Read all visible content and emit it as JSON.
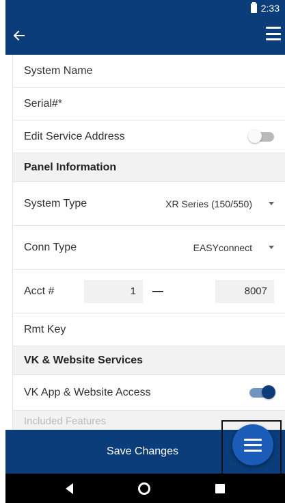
{
  "status_bar": {
    "time": "2:33"
  },
  "app_bar": {
    "back_icon": "arrow-left-icon",
    "menu_icon": "hamburger-menu-icon"
  },
  "form": {
    "system_name_placeholder": "System Name",
    "serial_placeholder": "Serial#*",
    "edit_service_address": {
      "label": "Edit Service Address",
      "enabled": false
    },
    "panel_section_title": "Panel Information",
    "system_type": {
      "label": "System Type",
      "value": "XR Series (150/550)"
    },
    "conn_type": {
      "label": "Conn Type",
      "value": "EASYconnect"
    },
    "acct": {
      "label": "Acct #",
      "prefix": "1",
      "number": "8007"
    },
    "rmt_key_placeholder": "Rmt Key",
    "vk_section_title": "VK & Website Services",
    "vk_access": {
      "label": "VK App & Website Access",
      "enabled": true
    },
    "cut_off_section_title": "Included Features"
  },
  "bottom_bar": {
    "save_label": "Save Changes"
  },
  "fab": {
    "icon": "hamburger-menu-icon"
  },
  "colors": {
    "primary": "#0b3d7a",
    "fab": "#1a5cb8",
    "toggle_on_track": "#7194c1",
    "toggle_off_track": "#b9b9b9"
  }
}
